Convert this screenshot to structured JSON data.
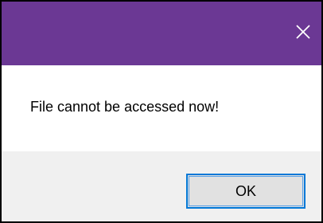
{
  "window": {
    "title": "",
    "close_icon": "close-icon",
    "title_bar_color": "#6b3894"
  },
  "message": {
    "text": "File cannot be accessed now!"
  },
  "buttons": {
    "ok_label": "OK",
    "focus_color": "#0078d7"
  }
}
